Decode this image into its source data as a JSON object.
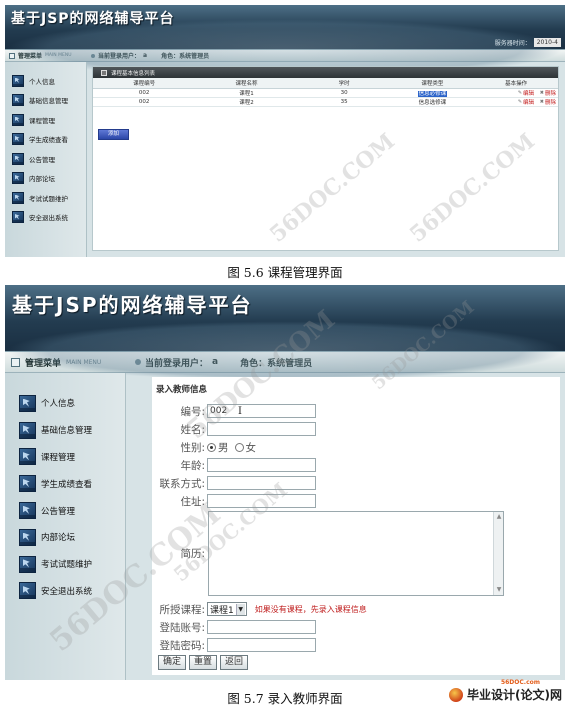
{
  "screen1": {
    "app_title": "基于JSP的网络辅导平台",
    "time_label": "服务器时间：",
    "time_value": "2010-4",
    "menu_title": "管理菜单",
    "menu_title_en": "MAIN MENU",
    "login_user_label": "当前登录用户：",
    "login_user": "a",
    "role_label": "角色：系统管理员",
    "sidebar": [
      "个人信息",
      "基础信息管理",
      "课程管理",
      "学生成绩查看",
      "公告管理",
      "内部论坛",
      "考试试题维护",
      "安全退出系统"
    ],
    "panel_title": "课程基本信息列表",
    "columns": [
      "课程编号",
      "课程名称",
      "学时",
      "课程类型",
      "基本操作"
    ],
    "rows": [
      {
        "id": "002",
        "name": "课程1",
        "hours": "30",
        "type": "信息必修课",
        "edit": "编辑",
        "del": "删除"
      },
      {
        "id": "002",
        "name": "课程2",
        "hours": "35",
        "type": "信息选修课",
        "edit": "编辑",
        "del": "删除"
      }
    ],
    "add_button": "添加"
  },
  "caption1": "图 5.6 课程管理界面",
  "screen2": {
    "app_title": "基于JSP的网络辅导平台",
    "menu_title": "管理菜单",
    "menu_title_en": "MAIN MENU",
    "login_user_label": "当前登录用户：",
    "login_user": "a",
    "role_label": "角色：系统管理员",
    "sidebar": [
      "个人信息",
      "基础信息管理",
      "课程管理",
      "学生成绩查看",
      "公告管理",
      "内部论坛",
      "考试试题维护",
      "安全退出系统"
    ],
    "form_title": "录入教师信息",
    "fields": {
      "number_label": "编号:",
      "number_value": "002",
      "name_label": "姓名:",
      "gender_label": "性别:",
      "male": "男",
      "female": "女",
      "age_label": "年龄:",
      "contact_label": "联系方式:",
      "address_label": "住址:",
      "resume_label": "简历:",
      "course_label": "所授课程:",
      "course_value": "课程1",
      "course_hint": "如果没有课程，先录入课程信息",
      "account_label": "登陆账号:",
      "password_label": "登陆密码:"
    },
    "buttons": {
      "confirm": "确定",
      "reset": "重置",
      "back": "返回"
    }
  },
  "caption2": "图 5.7 录入教师界面",
  "footer": {
    "logo_text": "毕业设计(论文)网",
    "site": "56DOC.com"
  },
  "watermark": "56DOC.COM",
  "colors": {
    "banner": "#233c50",
    "highlight": "#2b63c9",
    "warning": "#c02020",
    "sidebar_bg": "#d7e3e6"
  },
  "icons": {
    "sidebar_item": "monitor-icon",
    "radio": "radio-icon",
    "dropdown": "chevron-down-icon"
  }
}
